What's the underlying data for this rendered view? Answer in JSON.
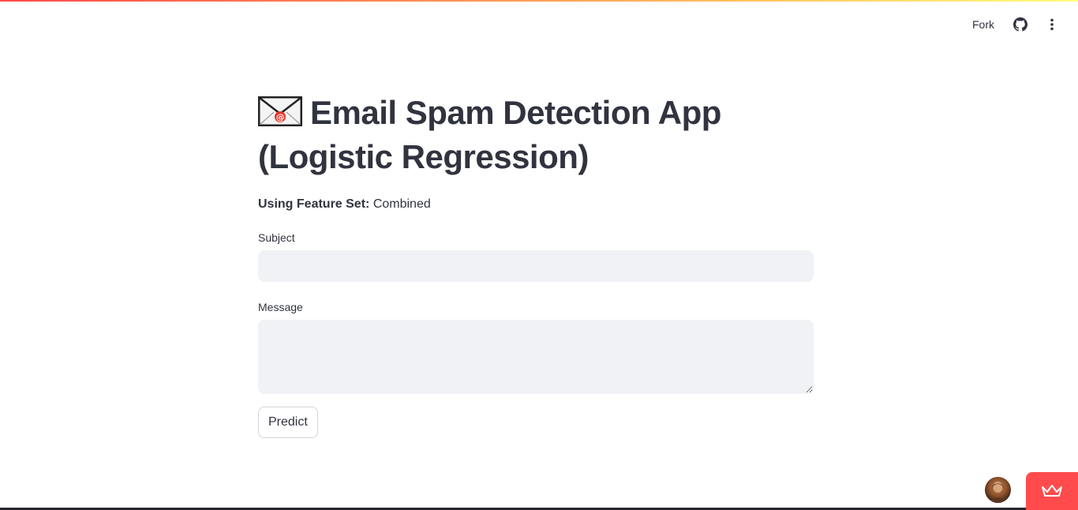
{
  "header": {
    "fork_label": "Fork",
    "github_icon": "github-icon",
    "menu_icon": "more-vertical-icon"
  },
  "main": {
    "title_icon": "envelope-at-icon",
    "title": "Email Spam Detection App (Logistic Regression)",
    "feature_set_label": "Using Feature Set:",
    "feature_set_value": "Combined",
    "subject_label": "Subject",
    "subject_value": "",
    "message_label": "Message",
    "message_value": "",
    "predict_label": "Predict"
  },
  "footer": {
    "avatar_icon": "user-avatar",
    "badge_icon": "streamlit-crown-icon",
    "badge_color": "#ff4b4b"
  }
}
